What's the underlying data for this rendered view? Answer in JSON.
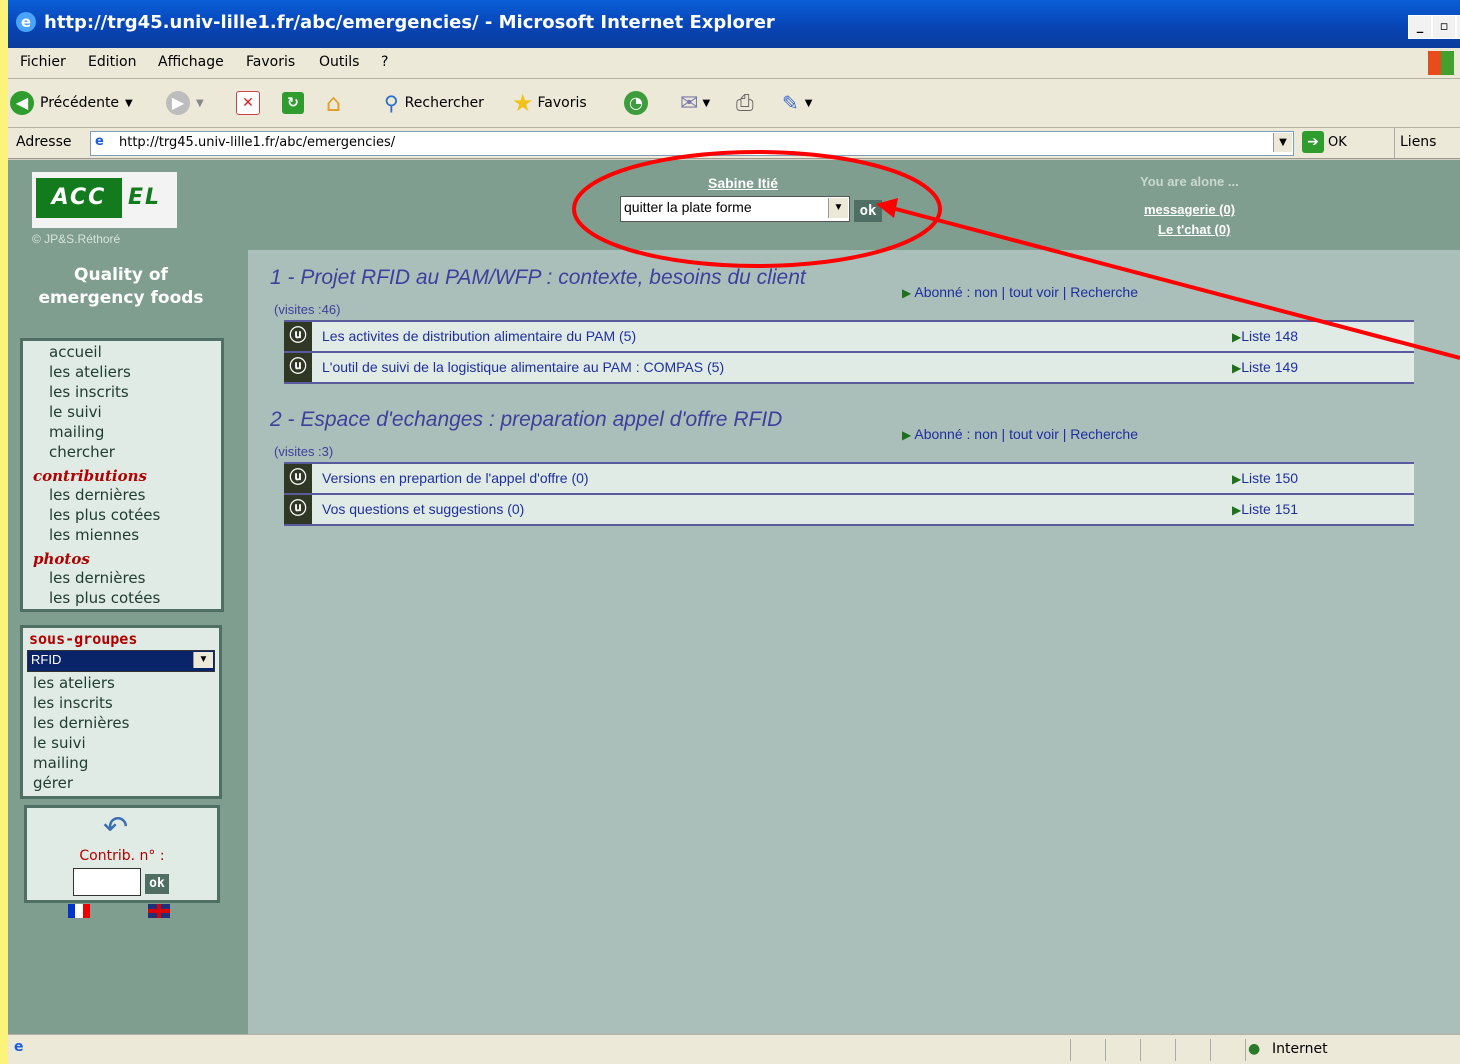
{
  "window": {
    "title": "http://trg45.univ-lille1.fr/abc/emergencies/ - Microsoft Internet Explorer",
    "controls": [
      "_",
      "▫",
      "x"
    ]
  },
  "menubar": [
    "Fichier",
    "Edition",
    "Affichage",
    "Favoris",
    "Outils",
    "?"
  ],
  "toolbar": {
    "back": "Précédente",
    "search": "Rechercher",
    "favorites": "Favoris"
  },
  "address": {
    "label": "Adresse",
    "url": "http://trg45.univ-lille1.fr/abc/emergencies/",
    "go": "OK",
    "links": "Liens"
  },
  "header": {
    "logo_left": "ACC",
    "logo_right": "EL",
    "copyright": "© JP&S.Réthoré",
    "user": "Sabine Itié",
    "select_value": "quitter la plate forme",
    "ok": "ok",
    "alone": "You are alone ...",
    "messagerie": "messagerie (0)",
    "tchat": "Le t'chat (0)"
  },
  "sidebar": {
    "title_line1": "Quality of",
    "title_line2": "emergency foods",
    "nav": [
      "accueil",
      "les ateliers",
      "les inscrits",
      "le suivi",
      "mailing",
      "chercher"
    ],
    "contributions_header": "contributions",
    "contributions": [
      "les dernières",
      "les plus cotées",
      "les miennes"
    ],
    "photos_header": "photos",
    "photos": [
      "les dernières",
      "les plus cotées"
    ],
    "subgroups_header": "sous-groupes",
    "subgroup_select": "RFID",
    "subgroups": [
      "les ateliers",
      "les inscrits",
      "les dernières",
      "le suivi",
      "mailing",
      "gérer"
    ],
    "contrib_label": "Contrib. n° :",
    "contrib_ok": "ok"
  },
  "sections": [
    {
      "title": "1 - Projet RFID au PAM/WFP : contexte, besoins du client",
      "visites": "(visites :46)",
      "sub": "Abonné : non | tout voir | Recherche",
      "rows": [
        {
          "text": "Les activites de distribution alimentaire du PAM (5)",
          "list": "Liste 148"
        },
        {
          "text": "L'outil de suivi de la logistique alimentaire au PAM : COMPAS (5)",
          "list": "Liste 149"
        }
      ]
    },
    {
      "title": "2 - Espace d'echanges : preparation appel d'offre RFID",
      "visites": "(visites :3)",
      "sub": "Abonné : non | tout voir | Recherche",
      "rows": [
        {
          "text": "Versions en prepartion de l'appel d'offre (0)",
          "list": "Liste 150"
        },
        {
          "text": "Vos questions et suggestions (0)",
          "list": "Liste 151"
        }
      ]
    }
  ],
  "statusbar": {
    "zone": "Internet"
  },
  "colors": {
    "annotation": "#ff0000",
    "accent_green": "#147a1e",
    "panel": "#7f9e8f",
    "content_bg": "#aabfba"
  }
}
